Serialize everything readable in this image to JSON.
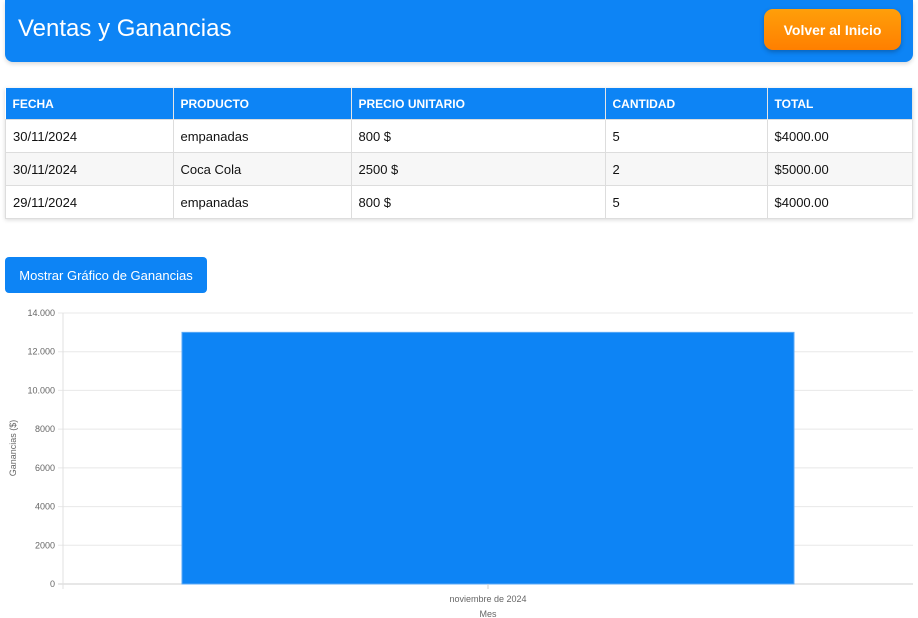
{
  "header": {
    "title": "Ventas y Ganancias",
    "back_button": "Volver al Inicio"
  },
  "table": {
    "columns": [
      "FECHA",
      "PRODUCTO",
      "PRECIO UNITARIO",
      "CANTIDAD",
      "TOTAL"
    ],
    "rows": [
      [
        "30/11/2024",
        "empanadas",
        "800 $",
        "5",
        "$4000.00"
      ],
      [
        "30/11/2024",
        "Coca Cola",
        "2500 $",
        "2",
        "$5000.00"
      ],
      [
        "29/11/2024",
        "empanadas",
        "800 $",
        "5",
        "$4000.00"
      ]
    ]
  },
  "chart_button": "Mostrar Gráfico de Ganancias",
  "colors": {
    "primary": "#0d84f5",
    "accent": "#ff8c00"
  },
  "chart_data": {
    "type": "bar",
    "categories": [
      "noviembre de 2024"
    ],
    "values": [
      13000
    ],
    "xlabel": "Mes",
    "ylabel": "Ganancias ($)",
    "ylim": [
      0,
      14000
    ],
    "yticks": [
      "0",
      "2000",
      "4000",
      "6000",
      "8000",
      "10.000",
      "12.000",
      "14.000"
    ],
    "grid": true,
    "legend": "none"
  }
}
